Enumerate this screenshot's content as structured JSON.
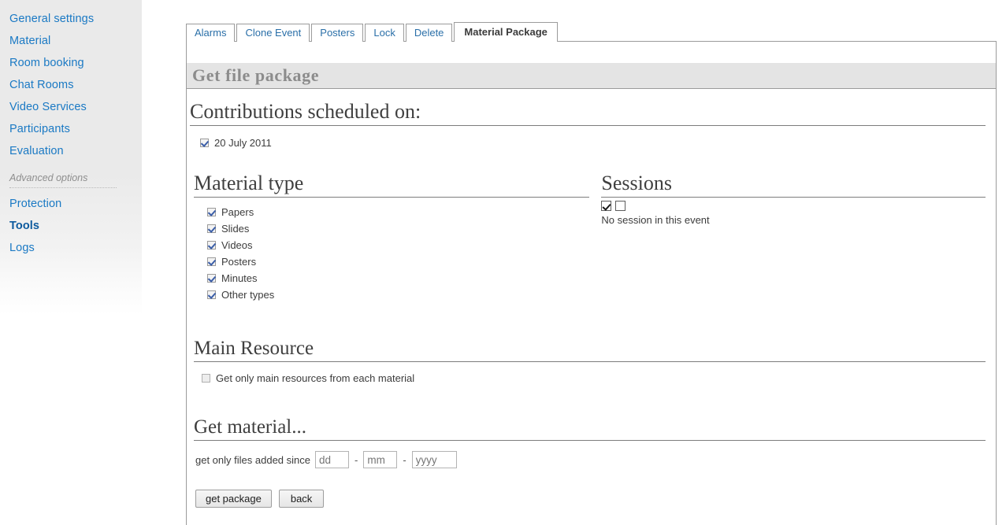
{
  "sidebar": {
    "items": [
      {
        "label": "General settings",
        "active": false
      },
      {
        "label": "Material",
        "active": false
      },
      {
        "label": "Room booking",
        "active": false
      },
      {
        "label": "Chat Rooms",
        "active": false
      },
      {
        "label": "Video Services",
        "active": false
      },
      {
        "label": "Participants",
        "active": false
      },
      {
        "label": "Evaluation",
        "active": false
      }
    ],
    "section_label": "Advanced options",
    "advanced_items": [
      {
        "label": "Protection",
        "active": false
      },
      {
        "label": "Tools",
        "active": true
      },
      {
        "label": "Logs",
        "active": false
      }
    ]
  },
  "tabs": [
    {
      "label": "Alarms",
      "active": false
    },
    {
      "label": "Clone Event",
      "active": false
    },
    {
      "label": "Posters",
      "active": false
    },
    {
      "label": "Lock",
      "active": false
    },
    {
      "label": "Delete",
      "active": false
    },
    {
      "label": "Material Package",
      "active": true
    }
  ],
  "header": {
    "title": "Get file package"
  },
  "contributions": {
    "title": "Contributions scheduled on:",
    "dates": [
      {
        "label": "20 July 2011",
        "checked": true
      }
    ]
  },
  "material_type": {
    "title": "Material type",
    "options": [
      {
        "label": "Papers",
        "checked": true
      },
      {
        "label": "Slides",
        "checked": true
      },
      {
        "label": "Videos",
        "checked": true
      },
      {
        "label": "Posters",
        "checked": true
      },
      {
        "label": "Minutes",
        "checked": true
      },
      {
        "label": "Other types",
        "checked": true
      }
    ]
  },
  "sessions": {
    "title": "Sessions",
    "select_all_checked": true,
    "select_none_checked": false,
    "empty_message": "No session in this event"
  },
  "main_resource": {
    "title": "Main Resource",
    "option_label": "Get only main resources from each material",
    "checked": false
  },
  "get_material": {
    "title": "Get material...",
    "since_label": "get only files added since",
    "day": {
      "value": "",
      "placeholder": "dd"
    },
    "month": {
      "value": "",
      "placeholder": "mm"
    },
    "year": {
      "value": "",
      "placeholder": "yyyy"
    },
    "separator": "-"
  },
  "actions": {
    "submit_label": "get package",
    "back_label": "back"
  },
  "colors": {
    "link": "#1a79c4",
    "active_link": "#0d5a9e",
    "header_bg": "#e4e4e4",
    "header_text": "#8c8c8c",
    "checkmark": "#3b5ea8",
    "panel_border": "#9b9b9b"
  }
}
